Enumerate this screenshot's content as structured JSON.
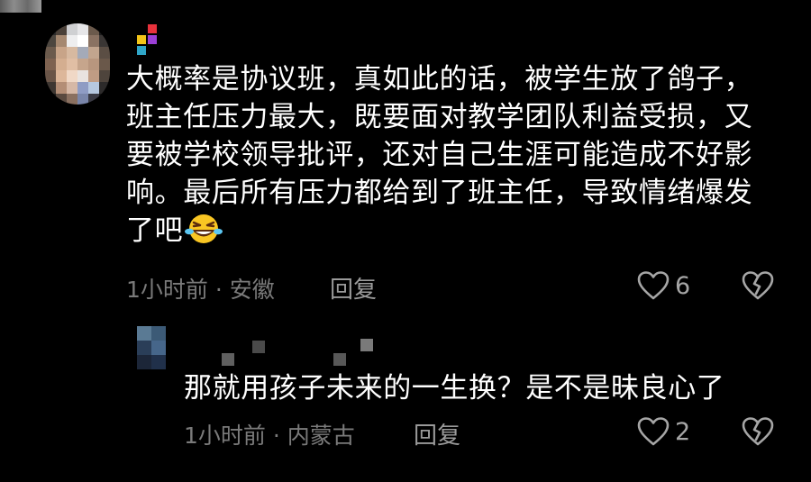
{
  "main_comment": {
    "text": "大概率是协议班，真如此的话，被学生放了鸽子，班主任压力最大，既要面对教学团队利益受损，又要被学校领导批评，还对自己生涯可能造成不好影响。最后所有压力都给到了班主任，导致情绪爆发了吧",
    "emoji_icon": "rolling-laughing-emoji",
    "meta": "1小时前 · 安徽",
    "reply_label": "回复",
    "like_count": "6",
    "like_icon": "heart-outline-icon",
    "dislike_icon": "broken-heart-icon"
  },
  "reply_comment": {
    "text": "那就用孩子未来的一生换？是不是昧良心了",
    "meta": "1小时前 · 内蒙古",
    "reply_label": "回复",
    "like_count": "2",
    "like_icon": "heart-outline-icon",
    "dislike_icon": "broken-heart-icon"
  },
  "colors": {
    "background": "#000000",
    "text": "#ffffff",
    "meta": "#7a7a7a",
    "icon": "#a6a6a6"
  }
}
